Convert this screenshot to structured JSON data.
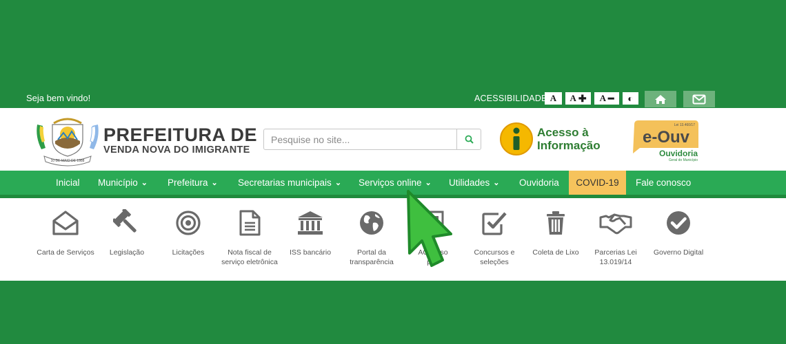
{
  "topbar": {
    "welcome": "Seja bem vindo!",
    "accessibility_label": "ACESSIBILIDADE:",
    "font_buttons": [
      {
        "letter": "A",
        "symbol": ""
      },
      {
        "letter": "A",
        "symbol": "✚"
      },
      {
        "letter": "A",
        "symbol": "━"
      },
      {
        "letter": "",
        "symbol": "◐"
      }
    ],
    "icons": [
      "home-icon",
      "mail-icon"
    ]
  },
  "header": {
    "brand_title": "PREFEITURA DE",
    "brand_subtitle": "VENDA NOVA DO IMIGRANTE",
    "logo_ribbon_text": "10 DE MAIO DE 1988",
    "search_placeholder": "Pesquise no site...",
    "acesso_line1": "Acesso à",
    "acesso_line2": "Informação",
    "eouv_law": "Lei 13.460/17",
    "eouv_name": "e-Ouv",
    "eouv_sub": "Ouvidoria",
    "eouv_sub2": "Geral do Município"
  },
  "nav": [
    {
      "label": "Inicial",
      "dropdown": ""
    },
    {
      "label": "Município",
      "dropdown": "⌄"
    },
    {
      "label": "Prefeitura",
      "dropdown": "⌄"
    },
    {
      "label": "Secretarias municipais",
      "dropdown": "⌄"
    },
    {
      "label": "Serviços online",
      "dropdown": "⌄"
    },
    {
      "label": "Utilidades",
      "dropdown": "⌄"
    },
    {
      "label": "Ouvidoria",
      "dropdown": ""
    },
    {
      "label": "COVID-19",
      "dropdown": ""
    },
    {
      "label": "Fale conosco",
      "dropdown": ""
    }
  ],
  "services": [
    {
      "line1": "Carta de Serviços",
      "line2": "",
      "icon": "envelope-open-icon"
    },
    {
      "line1": "Legislação",
      "line2": "",
      "icon": "gavel-icon"
    },
    {
      "line1": "Licitações",
      "line2": "",
      "icon": "bullseye-icon"
    },
    {
      "line1": "Nota fiscal de",
      "line2": "serviço eletrônica",
      "icon": "document-icon"
    },
    {
      "line1": "ISS bancário",
      "line2": "",
      "icon": "bank-icon"
    },
    {
      "line1": "Portal da",
      "line2": "transparência",
      "icon": "globe-icon"
    },
    {
      "line1": "AC   curso",
      "line2": "pub",
      "icon": "building-icon"
    },
    {
      "line1": "Concursos e",
      "line2": "seleções",
      "icon": "check-square-icon"
    },
    {
      "line1": "Coleta de Lixo",
      "line2": "",
      "icon": "trash-icon"
    },
    {
      "line1": "Parcerias Lei",
      "line2": "13.019/14",
      "icon": "handshake-icon"
    },
    {
      "line1": "Governo Digital",
      "line2": "",
      "icon": "check-circle-icon"
    }
  ],
  "colors": {
    "background_green": "#218a3f",
    "nav_green": "#2aaa55",
    "covid_yellow": "#f6c35c",
    "icon_gray": "#6a6a6a",
    "cursor_green": "#3fbf3f"
  }
}
